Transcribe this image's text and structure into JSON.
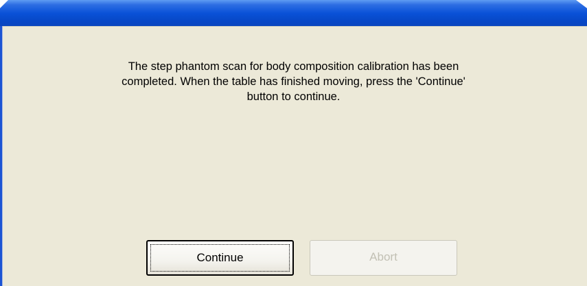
{
  "window": {
    "title": ""
  },
  "dialog": {
    "message_lines": [
      "The step phantom scan for body composition calibration has been",
      "completed.  When the table has finished moving, press the 'Continue'",
      "button to continue."
    ]
  },
  "buttons": {
    "continue_label": "Continue",
    "abort_label": "Abort",
    "abort_enabled": false
  },
  "colors": {
    "dialog_background": "#ece9d8",
    "titlebar_blue": "#0a52d8",
    "disabled_text": "#c2c0b4"
  }
}
